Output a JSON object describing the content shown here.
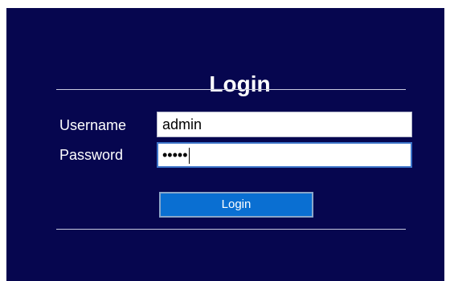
{
  "form": {
    "title": "Login",
    "username_label": "Username",
    "username_value": "admin",
    "password_label": "Password",
    "password_value": "•••••",
    "submit_label": "Login"
  },
  "colors": {
    "panel_background": "#06064f",
    "button_background": "#0a6fd2",
    "focus_border": "#3b73c8"
  }
}
